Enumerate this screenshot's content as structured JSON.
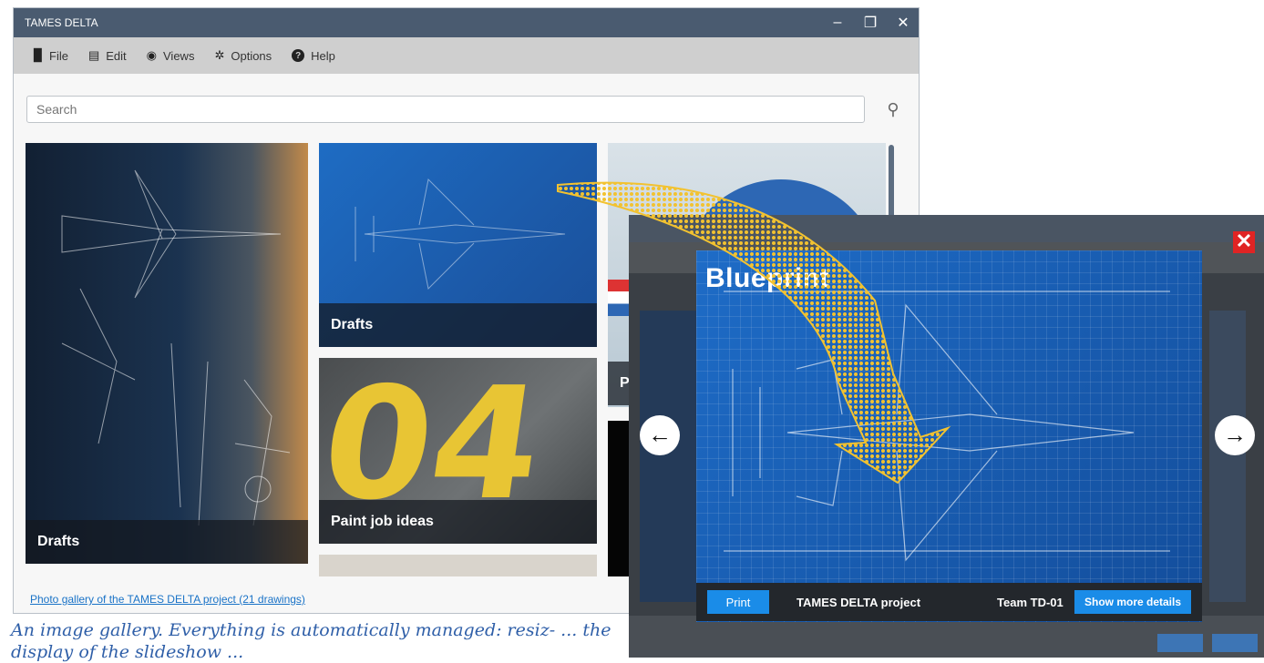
{
  "window": {
    "title": "TAMES DELTA",
    "controls": {
      "minimize": "–",
      "restore": "❐",
      "close": "✕"
    }
  },
  "menu": {
    "items": [
      {
        "label": "File",
        "icon": "file-icon",
        "glyph": "▉"
      },
      {
        "label": "Edit",
        "icon": "clipboard-icon",
        "glyph": "▤"
      },
      {
        "label": "Views",
        "icon": "eye-icon",
        "glyph": "◉"
      },
      {
        "label": "Options",
        "icon": "gear-icon",
        "glyph": "✲"
      },
      {
        "label": "Help",
        "icon": "help-icon",
        "glyph": "?"
      }
    ]
  },
  "search": {
    "placeholder": "Search",
    "icon": "search-icon",
    "glyph": "⚲"
  },
  "gallery": {
    "tiles": [
      {
        "caption": "Drafts"
      },
      {
        "caption": "Drafts"
      },
      {
        "caption": "Paint job ideas"
      },
      {
        "caption": ""
      },
      {
        "caption": "P"
      },
      {
        "caption": ""
      }
    ],
    "link": "Photo gallery of the TAMES DELTA project (21 drawings)"
  },
  "caption": "An image gallery. Everything is automatically managed: resiz- ... the display of the slideshow ...",
  "viewer": {
    "close_glyph": "✕",
    "prev_glyph": "←",
    "next_glyph": "→",
    "photo_title": "Blueprint",
    "print_label": "Print",
    "project_label": "TAMES DELTA project",
    "team_label": "Team TD-01",
    "details_label": "Show more details",
    "accent_color": "#1a8ce8",
    "close_color": "#e02424"
  }
}
